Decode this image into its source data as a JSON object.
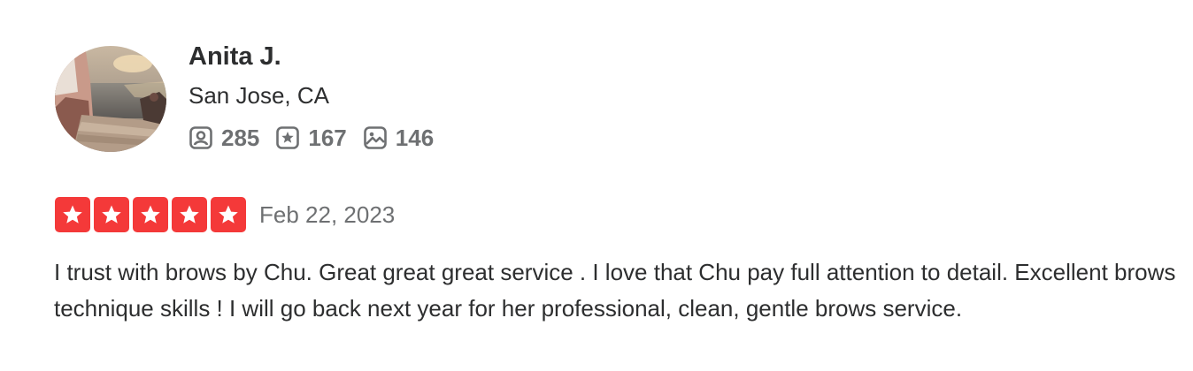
{
  "user": {
    "name": "Anita J.",
    "location": "San Jose, CA",
    "avatar_icon": "avatar-photo",
    "stats": [
      {
        "icon": "friends-icon",
        "value": "285"
      },
      {
        "icon": "reviews-icon",
        "value": "167"
      },
      {
        "icon": "photos-icon",
        "value": "146"
      }
    ]
  },
  "review": {
    "rating": 5,
    "rating_max": 5,
    "date": "Feb 22, 2023",
    "text": "I trust with brows by Chu. Great great great service . I love that Chu pay full attention to detail. Excellent brows technique skills ! I will go back next year for her professional, clean, gentle brows service."
  },
  "colors": {
    "star_active": "#f43939",
    "text_primary": "#2d2e2f",
    "text_secondary": "#6e7072"
  }
}
